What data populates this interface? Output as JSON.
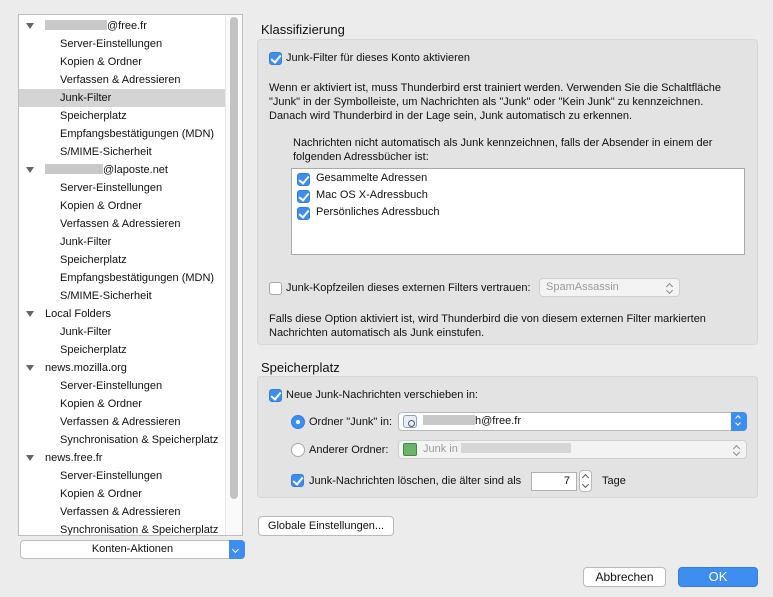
{
  "tree": {
    "rows": [
      {
        "type": "acct",
        "label": "@free.fr",
        "masked": true,
        "mask": "md"
      },
      {
        "type": "child",
        "label": "Server-Einstellungen"
      },
      {
        "type": "child",
        "label": "Kopien & Ordner"
      },
      {
        "type": "child",
        "label": "Verfassen & Adressieren"
      },
      {
        "type": "child",
        "label": "Junk-Filter",
        "selected": true
      },
      {
        "type": "child",
        "label": "Speicherplatz"
      },
      {
        "type": "child",
        "label": "Empfangsbestätigungen (MDN)"
      },
      {
        "type": "child",
        "label": "S/MIME-Sicherheit"
      },
      {
        "type": "acct",
        "label": "@laposte.net",
        "masked": true,
        "mask": "sm"
      },
      {
        "type": "child",
        "label": "Server-Einstellungen"
      },
      {
        "type": "child",
        "label": "Kopien & Ordner"
      },
      {
        "type": "child",
        "label": "Verfassen & Adressieren"
      },
      {
        "type": "child",
        "label": "Junk-Filter"
      },
      {
        "type": "child",
        "label": "Speicherplatz"
      },
      {
        "type": "child",
        "label": "Empfangsbestätigungen (MDN)"
      },
      {
        "type": "child",
        "label": "S/MIME-Sicherheit"
      },
      {
        "type": "acct",
        "label": "Local Folders"
      },
      {
        "type": "child",
        "label": "Junk-Filter"
      },
      {
        "type": "child",
        "label": "Speicherplatz"
      },
      {
        "type": "acct",
        "label": "news.mozilla.org"
      },
      {
        "type": "child",
        "label": "Server-Einstellungen"
      },
      {
        "type": "child",
        "label": "Kopien & Ordner"
      },
      {
        "type": "child",
        "label": "Verfassen & Adressieren"
      },
      {
        "type": "child",
        "label": "Synchronisation & Speicherplatz"
      },
      {
        "type": "acct",
        "label": "news.free.fr"
      },
      {
        "type": "child",
        "label": "Server-Einstellungen"
      },
      {
        "type": "child",
        "label": "Kopien & Ordner"
      },
      {
        "type": "child",
        "label": "Verfassen & Adressieren"
      },
      {
        "type": "child",
        "label": "Synchronisation & Speicherplatz"
      }
    ]
  },
  "konten_aktionen": "Konten-Aktionen",
  "klassifizierung": {
    "title": "Klassifizierung",
    "enable_label": "Junk-Filter für dieses Konto aktivieren",
    "enable_checked": true,
    "info_line1": "Wenn er aktiviert ist, muss Thunderbird erst trainiert werden. Verwenden Sie die Schaltfläche",
    "info_line2": "\"Junk\" in der Symbolleiste, um Nachrichten als \"Junk\" oder \"Kein Junk\" zu kennzeichnen.",
    "info_line3": "Danach wird Thunderbird in der Lage sein, Junk automatisch zu erkennen.",
    "whitelist_line1": "Nachrichten nicht automatisch als Junk kennzeichnen, falls der Absender in einem der",
    "whitelist_line2": "folgenden Adressbücher ist:",
    "addressbooks": [
      {
        "label": "Gesammelte Adressen",
        "checked": true
      },
      {
        "label": "Mac OS X-Adressbuch",
        "checked": true
      },
      {
        "label": "Persönliches Adressbuch",
        "checked": true
      }
    ],
    "trust_label": "Junk-Kopfzeilen dieses externen Filters vertrauen:",
    "trust_checked": false,
    "trust_select": "SpamAssassin",
    "trust_info_line1": "Falls diese Option aktiviert ist, wird Thunderbird die von diesem externen Filter markierten",
    "trust_info_line2": "Nachrichten automatisch als Junk einstufen."
  },
  "speicherplatz": {
    "title": "Speicherplatz",
    "move_label": "Neue Junk-Nachrichten verschieben in:",
    "move_checked": true,
    "radio_junk_label": "Ordner \"Junk\" in:",
    "radio_junk_selected": true,
    "junk_folder_value": "h@free.fr",
    "radio_other_label": "Anderer Ordner:",
    "radio_other_selected": false,
    "other_folder_value": "Junk in",
    "delete_label": "Junk-Nachrichten löschen, die älter sind als",
    "delete_checked": true,
    "delete_days": "7",
    "days_unit": "Tage"
  },
  "global_button": "Globale Einstellungen...",
  "cancel_button": "Abbrechen",
  "ok_button": "OK"
}
